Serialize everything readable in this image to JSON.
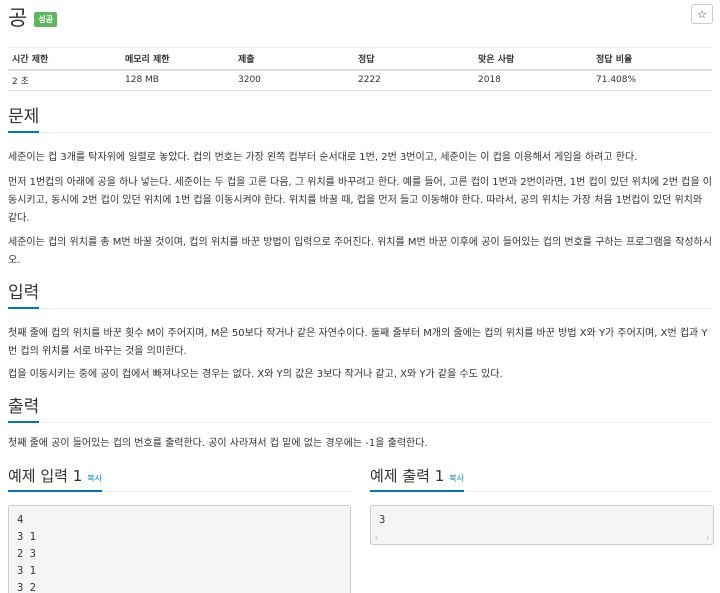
{
  "problem": {
    "title": "공",
    "status_badge": "성공",
    "star_icon": "☆"
  },
  "info_table": {
    "headers": [
      "시간 제한",
      "메모리 제한",
      "제출",
      "정답",
      "맞은 사람",
      "정답 비율"
    ],
    "values": [
      "2 초",
      "128 MB",
      "3200",
      "2222",
      "2018",
      "71.408%"
    ]
  },
  "sections": {
    "description_title": "문제",
    "description": [
      "세준이는 컵 3개를 탁자위에 일렬로 놓았다. 컵의 번호는 가장 왼쪽 컵부터 순서대로 1번, 2번 3번이고, 세준이는 이 컵을 이용해서 게임을 하려고 한다.",
      "먼저 1번컵의 아래에 공을 하나 넣는다. 세준이는 두 컵을 고른 다음, 그 위치를 바꾸려고 한다. 예를 들어, 고른 컵이 1번과 2번이라면, 1번 컵이 있던 위치에 2번 컵을 이동시키고, 동시에 2번 컵이 있던 위치에 1번 컵을 이동시켜야 한다. 위치를 바꿀 때, 컵을 먼저 들고 이동해야 한다. 따라서, 공의 위치는 가장 처음 1번컵이 있던 위치와 같다.",
      "세준이는 컵의 위치를 총 M번 바꿀 것이며, 컵의 위치를 바꾼 방법이 입력으로 주어진다. 위치를 M번 바꾼 이후에 공이 들어있는 컵의 번호를 구하는 프로그램을 작성하시오."
    ],
    "input_title": "입력",
    "input": [
      "첫째 줄에 컵의 위치를 바꾼 횟수 M이 주어지며, M은 50보다 작거나 같은 자연수이다. 둘째 줄부터 M개의 줄에는 컵의 위치를 바꾼 방법 X와 Y가 주어지며, X번 컵과 Y번 컵의 위치를 서로 바꾸는 것을 의미한다.",
      "컵을 이동시키는 중에 공이 컵에서 빠져나오는 경우는 없다. X와 Y의 값은 3보다 작거나 같고, X와 Y가 같을 수도 있다."
    ],
    "output_title": "출력",
    "output": [
      "첫째 줄에 공이 들어있는 컵의 번호를 출력한다. 공이 사라져서 컵 밑에 없는 경우에는 -1을 출력한다."
    ]
  },
  "samples": {
    "input_title": "예제 입력 1",
    "output_title": "예제 출력 1",
    "copy_label": "복사",
    "input_lines": [
      "4",
      "3 1",
      "2 3",
      "3 1",
      "3 2"
    ],
    "output_lines": [
      "3"
    ],
    "scroll_left": "‹",
    "scroll_right": "›"
  }
}
